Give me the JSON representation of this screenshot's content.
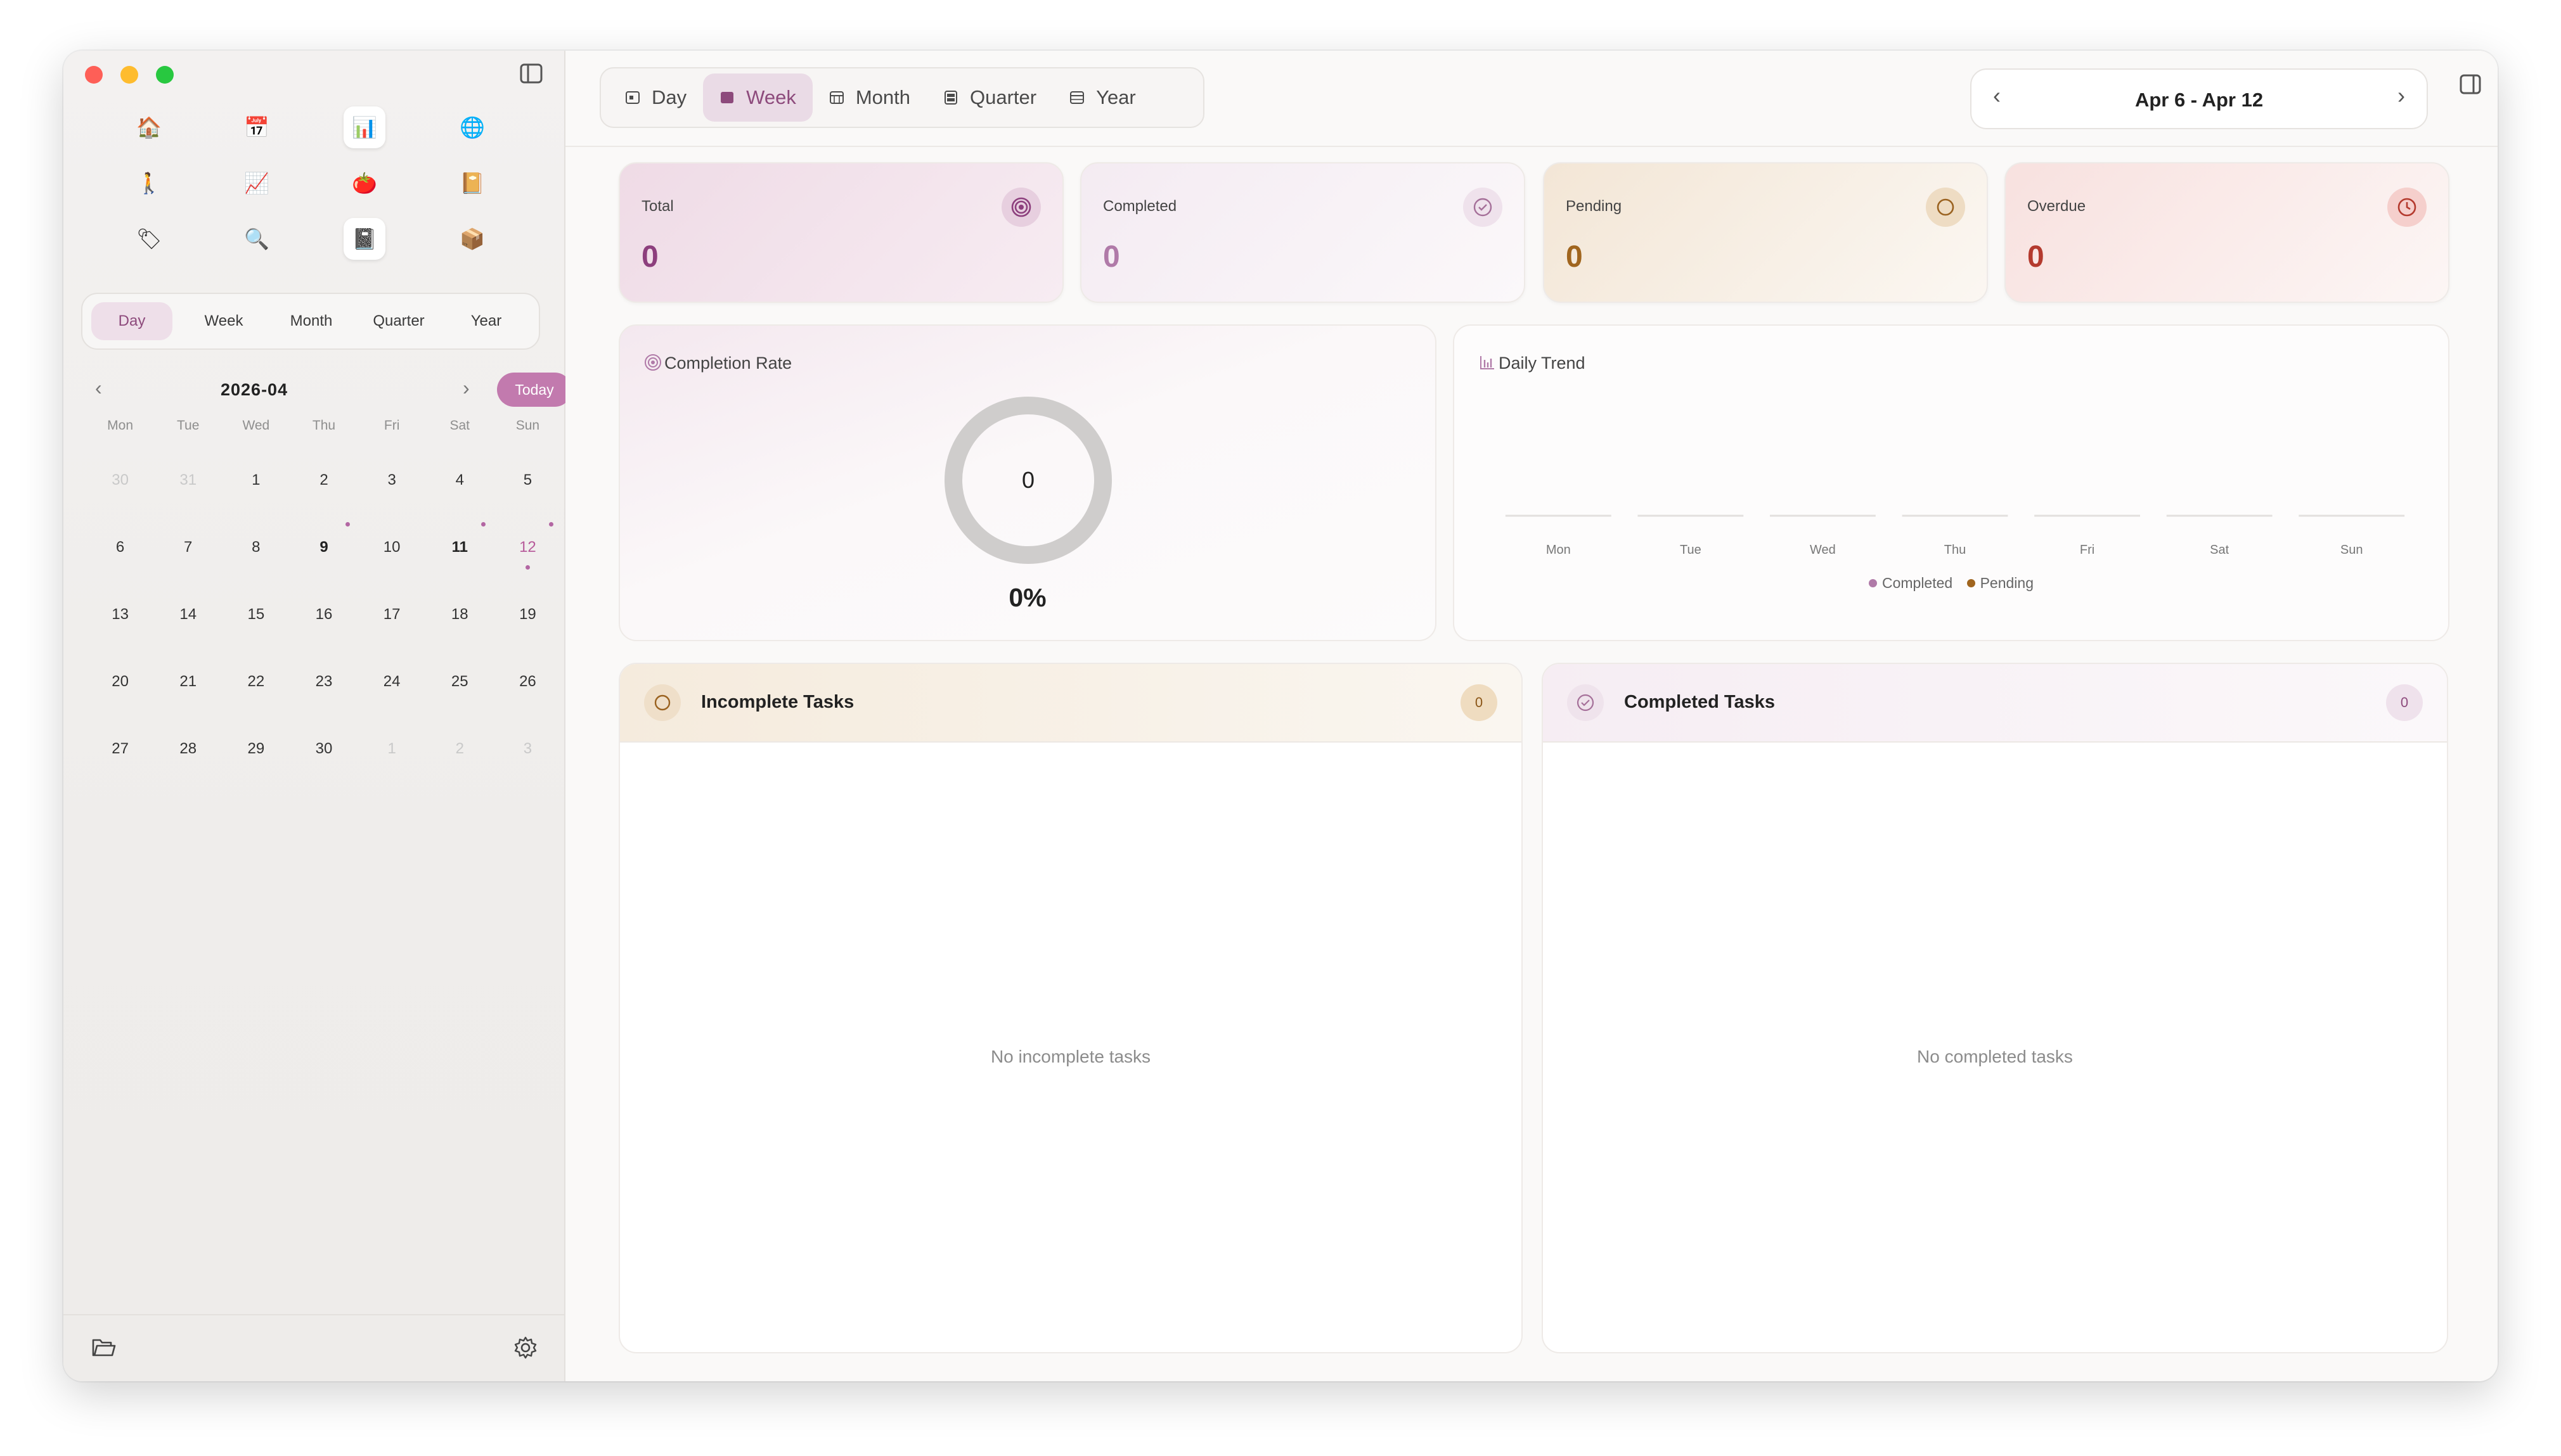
{
  "sidebar": {
    "icons": [
      {
        "name": "home-icon",
        "glyph": "🏠",
        "selected": false
      },
      {
        "name": "calendar-icon",
        "glyph": "📅",
        "selected": false
      },
      {
        "name": "bar-chart-icon",
        "glyph": "📊",
        "selected": true
      },
      {
        "name": "globe-icon",
        "glyph": "🌐",
        "selected": false
      },
      {
        "name": "walking-person-icon",
        "glyph": "🚶",
        "selected": false
      },
      {
        "name": "trend-chart-icon",
        "glyph": "📈",
        "selected": false
      },
      {
        "name": "tomato-icon",
        "glyph": "🍅",
        "selected": false
      },
      {
        "name": "notebook-icon",
        "glyph": "📔",
        "selected": false
      },
      {
        "name": "tag-icon",
        "glyph": "🏷",
        "selected": false
      },
      {
        "name": "magnifier-icon",
        "glyph": "🔍",
        "selected": false
      },
      {
        "name": "journal-icon",
        "glyph": "📓",
        "selected": true
      },
      {
        "name": "box-icon",
        "glyph": "📦",
        "selected": false
      }
    ],
    "periods": [
      "Day",
      "Week",
      "Month",
      "Quarter",
      "Year"
    ],
    "active_period": "Day",
    "calendar": {
      "title": "2026-04",
      "today_label": "Today",
      "weekdays": [
        "Mon",
        "Tue",
        "Wed",
        "Thu",
        "Fri",
        "Sat",
        "Sun"
      ],
      "days": [
        {
          "d": "30",
          "muted": true
        },
        {
          "d": "31",
          "muted": true
        },
        {
          "d": "1"
        },
        {
          "d": "2"
        },
        {
          "d": "3"
        },
        {
          "d": "4"
        },
        {
          "d": "5"
        },
        {
          "d": "6"
        },
        {
          "d": "7"
        },
        {
          "d": "8"
        },
        {
          "d": "9",
          "bold": true,
          "dot": "top"
        },
        {
          "d": "10"
        },
        {
          "d": "11",
          "bold": true,
          "dot": "top"
        },
        {
          "d": "12",
          "sun": true,
          "dot": "both"
        },
        {
          "d": "13"
        },
        {
          "d": "14"
        },
        {
          "d": "15"
        },
        {
          "d": "16"
        },
        {
          "d": "17"
        },
        {
          "d": "18"
        },
        {
          "d": "19"
        },
        {
          "d": "20"
        },
        {
          "d": "21"
        },
        {
          "d": "22"
        },
        {
          "d": "23"
        },
        {
          "d": "24"
        },
        {
          "d": "25"
        },
        {
          "d": "26"
        },
        {
          "d": "27"
        },
        {
          "d": "28"
        },
        {
          "d": "29"
        },
        {
          "d": "30"
        },
        {
          "d": "1",
          "muted": true
        },
        {
          "d": "2",
          "muted": true
        },
        {
          "d": "3",
          "muted": true
        }
      ]
    }
  },
  "toolbar": {
    "periods": [
      {
        "label": "Day",
        "icon": "day-calendar-icon"
      },
      {
        "label": "Week",
        "icon": "week-calendar-icon"
      },
      {
        "label": "Month",
        "icon": "month-calendar-icon"
      },
      {
        "label": "Quarter",
        "icon": "quarter-calendar-icon"
      },
      {
        "label": "Year",
        "icon": "year-calendar-icon"
      }
    ],
    "active": "Week",
    "range_label": "Apr 6 - Apr 12"
  },
  "stats": [
    {
      "label": "Total",
      "value": "0",
      "color": "#8d3f7d",
      "icon": "target-icon"
    },
    {
      "label": "Completed",
      "value": "0",
      "color": "#b07aa8",
      "icon": "check-circle-icon"
    },
    {
      "label": "Pending",
      "value": "0",
      "color": "#a0651e",
      "icon": "circle-icon"
    },
    {
      "label": "Overdue",
      "value": "0",
      "color": "#b43a2e",
      "icon": "clock-icon"
    }
  ],
  "completion": {
    "title": "Completion Rate",
    "center": "0",
    "percent": "0%",
    "rate": 0
  },
  "trend": {
    "title": "Daily Trend"
  },
  "chart_data": {
    "type": "bar",
    "categories": [
      "Mon",
      "Tue",
      "Wed",
      "Thu",
      "Fri",
      "Sat",
      "Sun"
    ],
    "series": [
      {
        "name": "Completed",
        "values": [
          0,
          0,
          0,
          0,
          0,
          0,
          0
        ],
        "color": "#b07aa8"
      },
      {
        "name": "Pending",
        "values": [
          0,
          0,
          0,
          0,
          0,
          0,
          0
        ],
        "color": "#a0651e"
      }
    ],
    "legend": "bottom"
  },
  "incomplete": {
    "title": "Incomplete Tasks",
    "count": "0",
    "empty": "No incomplete tasks"
  },
  "completed": {
    "title": "Completed Tasks",
    "count": "0",
    "empty": "No completed tasks"
  },
  "colors": {
    "accent": "#c27aae",
    "accent_dark": "#8d4a7c"
  }
}
